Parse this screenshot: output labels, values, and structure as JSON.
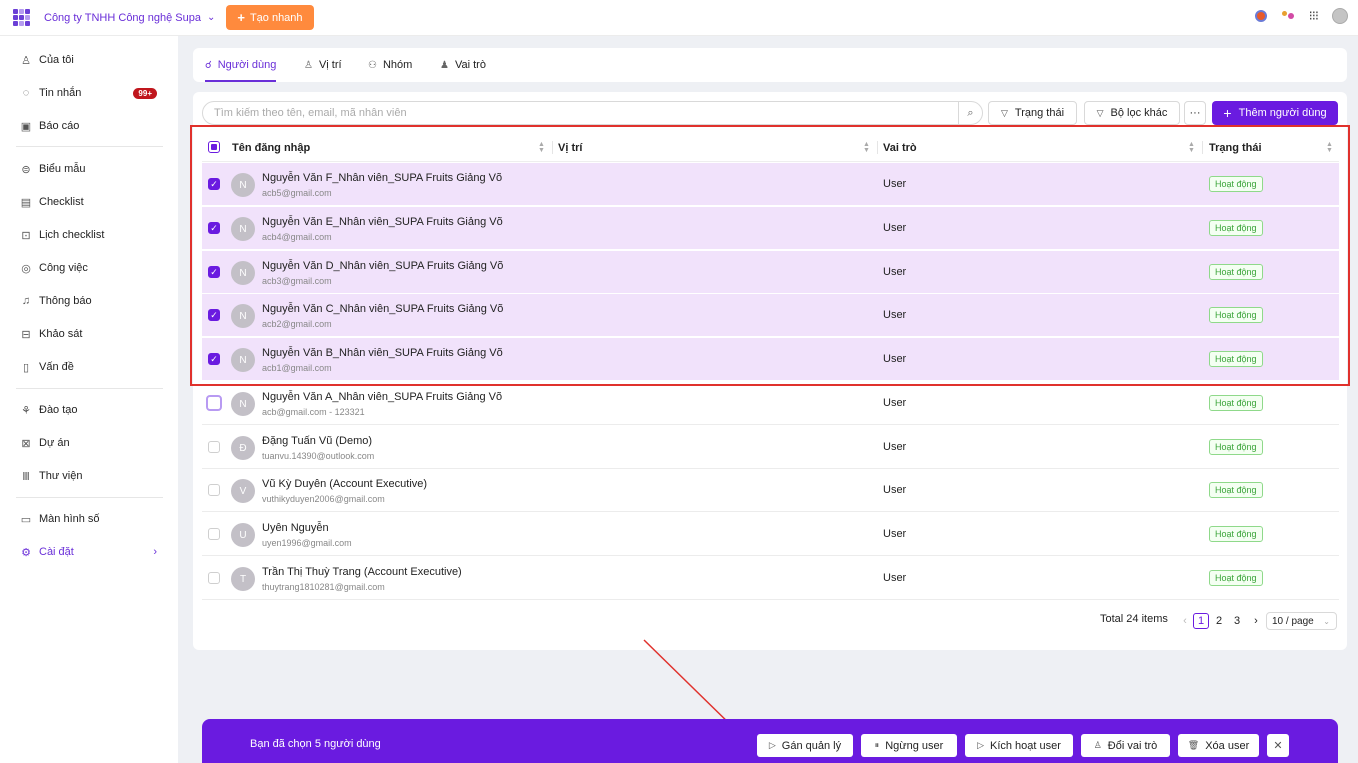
{
  "topbar": {
    "company": "Công ty TNHH Công nghệ Supa",
    "quick_create": "Tạo nhanh"
  },
  "sidebar": {
    "items": [
      {
        "label": "Của tôi",
        "icon": "person-heart-icon"
      },
      {
        "label": "Tin nhắn",
        "icon": "chat-icon",
        "badge": "99+"
      },
      {
        "label": "Báo cáo",
        "icon": "report-icon"
      },
      {
        "label": "Biểu mẫu",
        "icon": "form-icon"
      },
      {
        "label": "Checklist",
        "icon": "checklist-icon"
      },
      {
        "label": "Lịch checklist",
        "icon": "calendar-checklist-icon"
      },
      {
        "label": "Công việc",
        "icon": "task-icon"
      },
      {
        "label": "Thông báo",
        "icon": "bell-icon"
      },
      {
        "label": "Khảo sát",
        "icon": "survey-icon"
      },
      {
        "label": "Vấn đề",
        "icon": "issue-icon"
      },
      {
        "label": "Đào tạo",
        "icon": "training-icon"
      },
      {
        "label": "Dự án",
        "icon": "project-icon"
      },
      {
        "label": "Thư viện",
        "icon": "library-icon"
      },
      {
        "label": "Màn hình số",
        "icon": "monitor-icon"
      },
      {
        "label": "Cài đặt",
        "icon": "gear-icon",
        "active": true
      }
    ]
  },
  "tabs": [
    {
      "label": "Người dùng",
      "icon": "users-icon",
      "active": true
    },
    {
      "label": "Vị trí",
      "icon": "position-icon"
    },
    {
      "label": "Nhóm",
      "icon": "group-icon"
    },
    {
      "label": "Vai trò",
      "icon": "role-icon"
    }
  ],
  "toolbar": {
    "search_placeholder": "Tìm kiếm theo tên, email, mã nhân viên",
    "status_filter": "Trạng thái",
    "other_filter": "Bộ lọc khác",
    "more": "···",
    "add_user": "Thêm người dùng"
  },
  "table": {
    "headers": {
      "username": "Tên đăng nhập",
      "position": "Vị trí",
      "role": "Vai trò",
      "status": "Trạng thái"
    },
    "rows": [
      {
        "initial": "N",
        "name": "Nguyễn Văn F_Nhân viên_SUPA Fruits Giảng Võ",
        "email": "acb5@gmail.com",
        "role": "User",
        "status": "Hoạt động",
        "selected": true
      },
      {
        "initial": "N",
        "name": "Nguyễn Văn E_Nhân viên_SUPA Fruits Giảng Võ",
        "email": "acb4@gmail.com",
        "role": "User",
        "status": "Hoạt động",
        "selected": true
      },
      {
        "initial": "N",
        "name": "Nguyễn Văn D_Nhân viên_SUPA Fruits Giảng Võ",
        "email": "acb3@gmail.com",
        "role": "User",
        "status": "Hoạt động",
        "selected": true
      },
      {
        "initial": "N",
        "name": "Nguyễn Văn C_Nhân viên_SUPA Fruits Giảng Võ",
        "email": "acb2@gmail.com",
        "role": "User",
        "status": "Hoạt động",
        "selected": true
      },
      {
        "initial": "N",
        "name": "Nguyễn Văn B_Nhân viên_SUPA Fruits Giảng Võ",
        "email": "acb1@gmail.com",
        "role": "User",
        "status": "Hoạt động",
        "selected": true
      },
      {
        "initial": "N",
        "name": "Nguyễn Văn A_Nhân viên_SUPA Fruits Giảng Võ",
        "email": "acb@gmail.com - 123321",
        "role": "User",
        "status": "Hoạt động",
        "selected": false
      },
      {
        "initial": "Đ",
        "name": "Đặng Tuấn Vũ (Demo)",
        "email": "tuanvu.14390@outlook.com",
        "role": "User",
        "status": "Hoạt động",
        "selected": false
      },
      {
        "initial": "V",
        "name": "Vũ Kỳ Duyên (Account Executive)",
        "email": "vuthikyduyen2006@gmail.com",
        "role": "User",
        "status": "Hoạt động",
        "selected": false
      },
      {
        "initial": "U",
        "name": "Uyên Nguyễn",
        "email": "uyen1996@gmail.com",
        "role": "User",
        "status": "Hoạt động",
        "selected": false
      },
      {
        "initial": "T",
        "name": "Trần Thị Thuỳ Trang (Account Executive)",
        "email": "thuytrang1810281@gmail.com",
        "role": "User",
        "status": "Hoạt động",
        "selected": false
      }
    ]
  },
  "pagination": {
    "total": "Total 24 items",
    "pages": [
      "1",
      "2",
      "3"
    ],
    "current": "1",
    "page_size": "10 / page"
  },
  "bulk_bar": {
    "message": "Bạn đã chọn 5 người dùng",
    "actions": [
      {
        "label": "Gán quản lý",
        "icon": "play-icon"
      },
      {
        "label": "Ngừng user",
        "icon": "pause-icon"
      },
      {
        "label": "Kích hoạt user",
        "icon": "play-icon"
      },
      {
        "label": "Đổi vai trò",
        "icon": "user-switch-icon"
      },
      {
        "label": "Xóa user",
        "icon": "trash-icon"
      }
    ],
    "close": "✕"
  },
  "colors": {
    "accent": "#6a1be0",
    "quick": "#ff8a3d",
    "selected_row": "#f1e2fb",
    "highlight": "#e0312c",
    "status_green": "#3aa438"
  }
}
